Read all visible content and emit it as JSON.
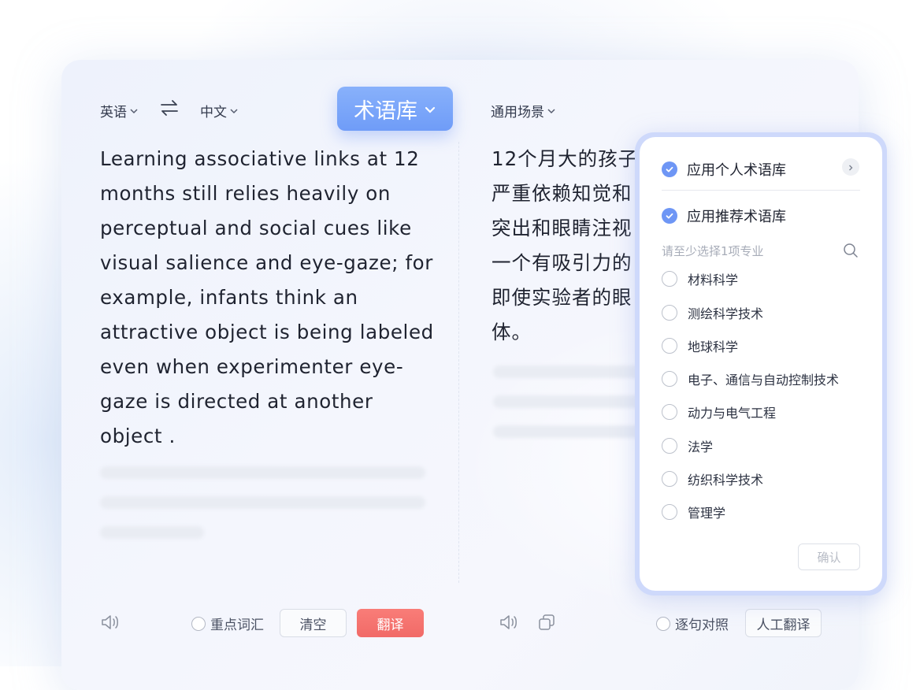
{
  "left_panel": {
    "source_lang": "英语",
    "target_lang": "中文",
    "source_text": "Learning associative links at 12 months still relies heavily on perceptual and social cues like visual salience and eye-gaze; for example, infants think an attractive object is being labeled even when experimenter eye-gaze is directed at another object .",
    "keyword_label": "重点词汇",
    "clear_label": "清空",
    "translate_label": "翻译"
  },
  "term_button": {
    "label": "术语库"
  },
  "right_panel": {
    "scene_label": "通用场景",
    "translated_text": "12个月大的孩子严重依赖知觉和突出和眼睛注视一个有吸引力的即使实验者的眼体。",
    "compare_label": "逐句对照",
    "human_label": "人工翻译"
  },
  "popup": {
    "personal_label": "应用个人术语库",
    "recommend_label": "应用推荐术语库",
    "hint": "请至少选择1项专业",
    "options": [
      "材料科学",
      "测绘科学技术",
      "地球科学",
      "电子、通信与自动控制技术",
      "动力与电气工程",
      "法学",
      "纺织科学技术",
      "管理学"
    ],
    "confirm_label": "确认"
  },
  "colors": {
    "accent": "#6e96f5",
    "translate_button": "#f16a67",
    "popup_border": "#ced9fb"
  }
}
